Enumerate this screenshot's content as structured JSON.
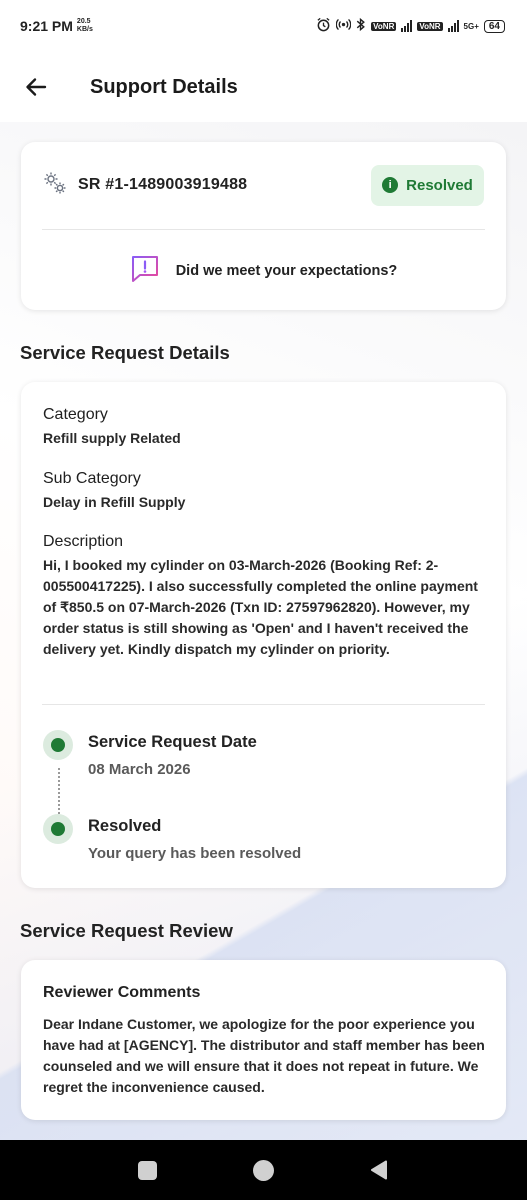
{
  "status_bar": {
    "time": "9:21 PM",
    "net_speed_value": "20.5",
    "net_speed_unit": "KB/s",
    "volte_1": "VoNR",
    "volte_2": "VoNR",
    "network": "5G+",
    "battery": "64"
  },
  "header": {
    "title": "Support Details",
    "back_icon": "arrow-left-icon"
  },
  "sr_card": {
    "sr_number": "SR #1-1489003919488",
    "sr_icon": "gears-icon",
    "status_label": "Resolved",
    "status_icon": "info-icon",
    "feedback_prompt": "Did we meet your expectations?",
    "feedback_icon": "message-alert-icon",
    "status_color": "#1f7a35"
  },
  "details_section": {
    "title": "Service Request Details",
    "category_label": "Category",
    "category_value": "Refill supply Related",
    "subcategory_label": "Sub Category",
    "subcategory_value": "Delay in Refill Supply",
    "description_label": "Description",
    "description_value": "Hi, I booked my cylinder on 03-March-2026 (Booking Ref: 2-005500417225). I also successfully completed the online payment of ₹850.5 on 07-March-2026 (Txn ID: 27597962820). However, my order status is still showing as 'Open' and I haven't received the delivery yet. Kindly dispatch my cylinder on priority.",
    "timeline": [
      {
        "title": "Service Request Date",
        "subtitle": "08 March 2026"
      },
      {
        "title": "Resolved",
        "subtitle": "Your query has been resolved"
      }
    ]
  },
  "review_section": {
    "title": "Service Request Review",
    "label": "Reviewer Comments",
    "comment": "Dear Indane Customer, we apologize for the poor experience you have had at [AGENCY]. The distributor and staff member has been counseled and we will ensure that it does not repeat in future. We regret the inconvenience caused."
  },
  "nav_bar": {
    "recents_icon": "square-icon",
    "home_icon": "circle-icon",
    "back_icon": "triangle-back-icon"
  }
}
